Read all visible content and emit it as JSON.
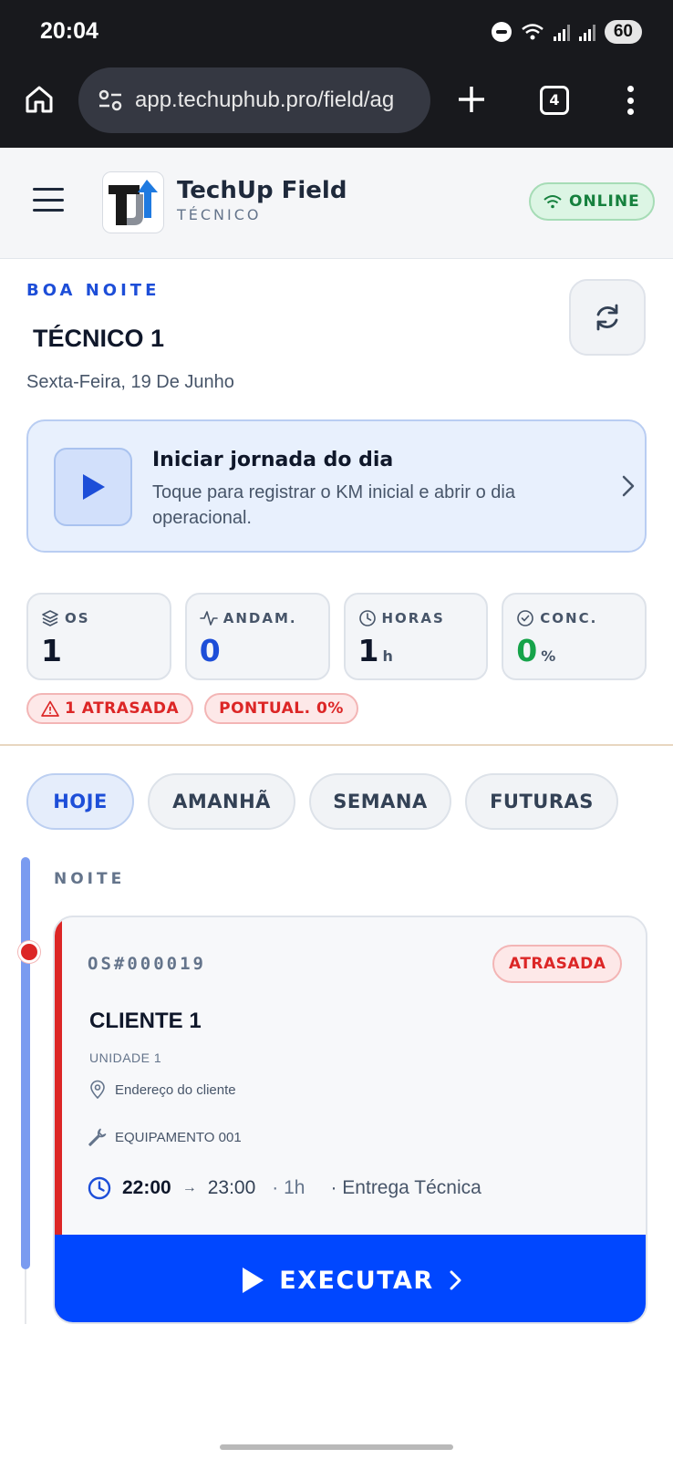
{
  "status_bar": {
    "time": "20:04",
    "battery": "60"
  },
  "browser": {
    "url": "app.techuphub.pro/field/ag",
    "tab_count": "4"
  },
  "header": {
    "brand_name": "TechUp Field",
    "brand_sub": "TÉCNICO",
    "connection_status": "ONLINE"
  },
  "greeting": {
    "salutation": "BOA NOITE",
    "technician": "TÉCNICO 1",
    "date": "Sexta-Feira, 19 De Junho"
  },
  "start_day": {
    "title": "Iniciar jornada do dia",
    "description": "Toque para registrar o KM inicial e abrir o dia operacional."
  },
  "stats": {
    "os": {
      "label": "OS",
      "value": "1"
    },
    "andamento": {
      "label": "ANDAM.",
      "value": "0"
    },
    "horas": {
      "label": "HORAS",
      "value": "1",
      "unit": "h"
    },
    "concluidas": {
      "label": "CONC.",
      "value": "0",
      "unit": "%"
    }
  },
  "alerts": {
    "atrasadas": "1 ATRASADA",
    "pontualidade": "PONTUAL. 0%"
  },
  "tabs": [
    "HOJE",
    "AMANHÃ",
    "SEMANA",
    "FUTURAS"
  ],
  "active_tab": "HOJE",
  "schedule": {
    "period": "NOITE",
    "order": {
      "id": "OS#000019",
      "status": "ATRASADA",
      "client": "CLIENTE 1",
      "unit": "UNIDADE 1",
      "address": "Endereço do cliente",
      "equipment": "EQUIPAMENTO 001",
      "start": "22:00",
      "arrow": "→",
      "end": "23:00",
      "duration": "· 1h",
      "type": "· Entrega Técnica",
      "action": "EXECUTAR"
    }
  },
  "colors": {
    "primary": "#0047ff",
    "danger": "#dc2626",
    "success": "#16a34a",
    "accent_blue": "#1d4ed8"
  },
  "icons": [
    "home-icon",
    "site-settings-icon",
    "plus-icon",
    "tabs-icon",
    "more-icon",
    "menu-icon",
    "wifi-icon",
    "refresh-icon",
    "play-icon",
    "chevron-right-icon",
    "layers-icon",
    "activity-icon",
    "clock-icon",
    "check-circle-icon",
    "warning-icon",
    "map-pin-icon",
    "wrench-icon"
  ]
}
